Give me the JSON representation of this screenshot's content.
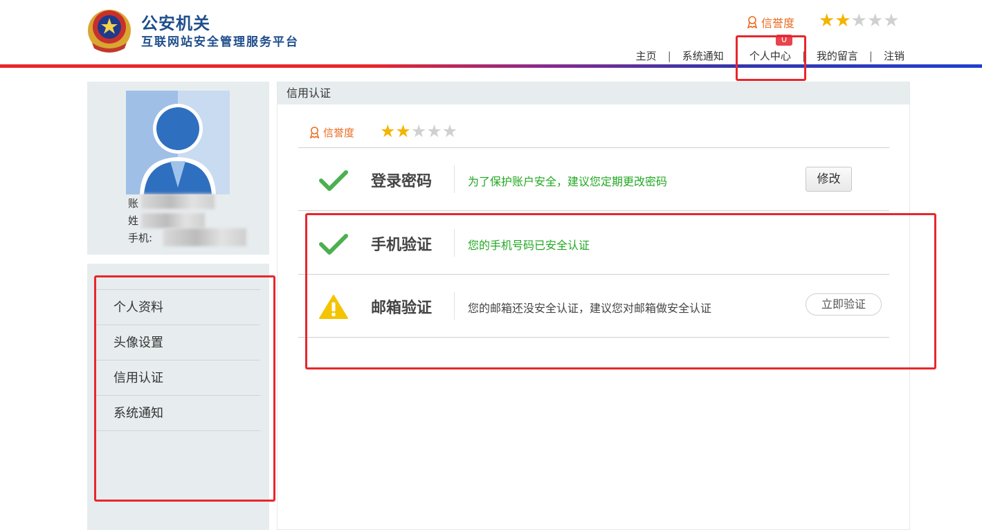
{
  "header": {
    "title": "公安机关",
    "subtitle": "互联网站安全管理服务平台",
    "credit_label": "信誉度",
    "rating": 2,
    "rating_max": 5,
    "nav": [
      "主页",
      "系统通知",
      "个人中心",
      "我的留言",
      "注销"
    ],
    "notification_count": "0"
  },
  "profile": {
    "account_label": "账",
    "name_label": "姓",
    "phone_label": "手机:"
  },
  "sidebar": {
    "items": [
      "个人资料",
      "头像设置",
      "信用认证",
      "系统通知"
    ]
  },
  "main": {
    "section_title": "信用认证",
    "credit_label": "信誉度",
    "rating": 2,
    "rows": [
      {
        "title": "登录密码",
        "desc": "为了保护账户安全，建议您定期更改密码",
        "status": "ok",
        "action": "修改"
      },
      {
        "title": "手机验证",
        "desc": "您的手机号码已安全认证",
        "status": "ok",
        "action": ""
      },
      {
        "title": "邮箱验证",
        "desc": "您的邮箱还没安全认证，建议您对邮箱做安全认证",
        "status": "warn",
        "action": "立即验证"
      }
    ]
  },
  "colors": {
    "brand": "#1f4e8c",
    "accent": "#ea6a1f",
    "ok": "#22a822",
    "warn": "#f4c400",
    "annotation": "#e8262c"
  }
}
